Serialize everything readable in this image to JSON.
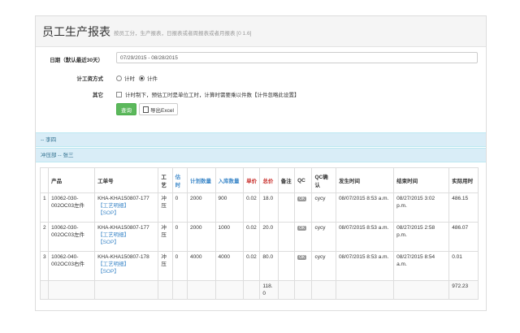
{
  "header": {
    "title": "员工生产报表",
    "subtitle": "按员工分，生产报表，日报表或者周报表或者月报表 [0 1.6]"
  },
  "form": {
    "date_label": "日期（默认最近30天）",
    "date_value": "07/29/2015 - 08/28/2015",
    "wage_label": "计工资方式",
    "wage_opt1": "计时",
    "wage_opt2": "计件",
    "other_label": "其它",
    "other_option": "计时制下，预估工时是单位工时，计算时需要乘以件数【计件忽略此设置】",
    "query_label": "查询",
    "export_label": "导出Excel"
  },
  "groups": {
    "g1": "-- 李四",
    "g2": "冲压部 -- 张三"
  },
  "table": {
    "headers": [
      "产品",
      "工单号",
      "工艺",
      "估时",
      "计划数量",
      "入库数量",
      "单价",
      "总价",
      "备注",
      "QC",
      "QC确认",
      "发生时间",
      "结束时间",
      "实际用时"
    ],
    "link1": "【工艺明细】",
    "link2": "【SOP】",
    "ok": "OK",
    "rows": [
      {
        "no": "1",
        "product": "10062-030-002OC03左件",
        "order": "KHA-KHA150807-177",
        "craft": "冲压",
        "est": "0",
        "plan": "2000",
        "stock": "900",
        "price": "0.02",
        "total": "18.0",
        "note": "",
        "qcc": "cycy",
        "start": "08/07/2015 8:53 a.m.",
        "end": "08/27/2015 3:02 p.m.",
        "actual": "486.15"
      },
      {
        "no": "2",
        "product": "10062-030-002OC03左件",
        "order": "KHA-KHA150807-177",
        "craft": "冲压",
        "est": "0",
        "plan": "2000",
        "stock": "1000",
        "price": "0.02",
        "total": "20.0",
        "note": "",
        "qcc": "cycy",
        "start": "08/07/2015 8:53 a.m.",
        "end": "08/27/2015 2:58 p.m.",
        "actual": "486.07"
      },
      {
        "no": "3",
        "product": "10062-040-002OC03右件",
        "order": "KHA-KHA150807-178",
        "craft": "冲压",
        "est": "0",
        "plan": "4000",
        "stock": "4000",
        "price": "0.02",
        "total": "80.0",
        "note": "",
        "qcc": "cycy",
        "start": "08/07/2015 8:53 a.m.",
        "end": "08/27/2015 8:54 a.m.",
        "actual": "0.01"
      }
    ],
    "sum_total": "118.0",
    "sum_actual": "972.23"
  }
}
